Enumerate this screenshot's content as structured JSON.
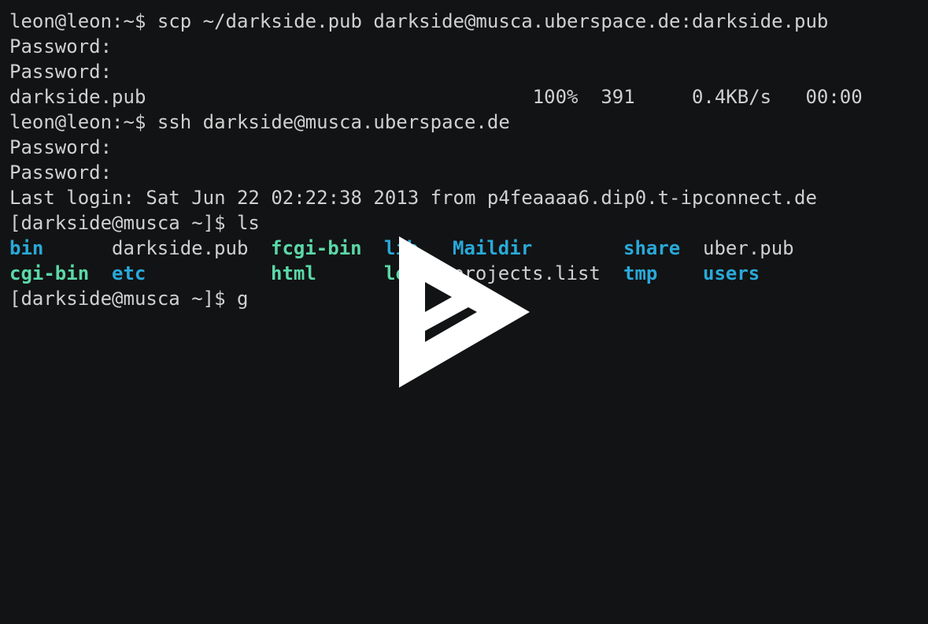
{
  "terminal": {
    "lines": [
      "leon@leon:~$ scp ~/darkside.pub darkside@musca.uberspace.de:darkside.pub",
      "Password:",
      "Password:",
      "darkside.pub                                  100%  391     0.4KB/s   00:00",
      "leon@leon:~$ ssh darkside@musca.uberspace.de",
      "Password:",
      "Password:",
      "Last login: Sat Jun 22 02:22:38 2013 from p4feaaaa6.dip0.t-ipconnect.de",
      "[darkside@musca ~]$ ls"
    ],
    "ls_row1": {
      "c1": "bin",
      "c2": "darkside.pub",
      "c3": "fcgi-bin",
      "c4": "lib",
      "c5": "Maildir",
      "c6": "share",
      "c7": "uber.pub"
    },
    "ls_row2": {
      "c1": "cgi-bin",
      "c2": "etc",
      "c3": "html",
      "c4": "logs",
      "c5": "projects.list",
      "c6": "tmp",
      "c7": "users"
    },
    "prompt_line": "[darkside@musca ~]$ g"
  },
  "colors": {
    "background": "#121314",
    "text": "#d0d0d0",
    "directory": "#29a9d9",
    "executable": "#5bd8a8",
    "overlay": "#ffffff"
  },
  "icons": {
    "overlay": "play-logo-icon"
  }
}
